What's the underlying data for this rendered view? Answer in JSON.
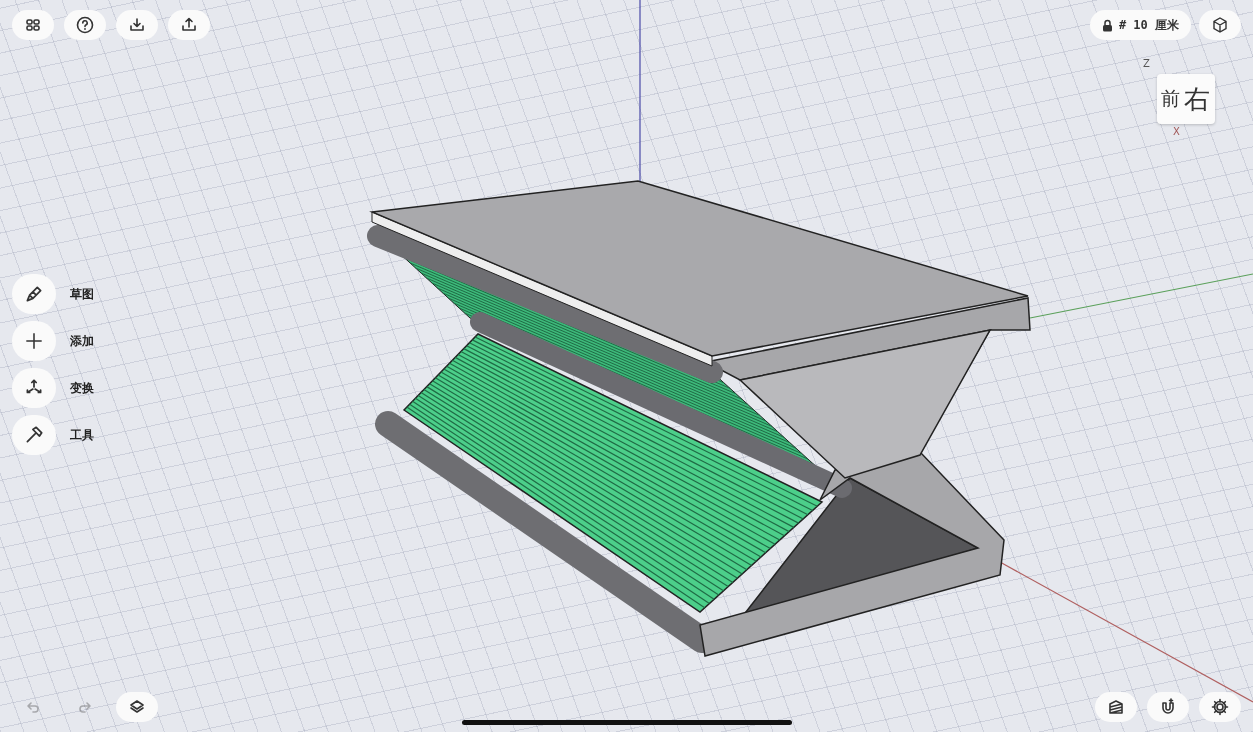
{
  "top_toolbar": [
    {
      "kind": "grid"
    },
    {
      "kind": "help"
    },
    {
      "kind": "import"
    },
    {
      "kind": "export"
    }
  ],
  "grid_size": {
    "label": "# 10 厘米",
    "locked": true
  },
  "view_cube": {
    "front": "前",
    "right": "右",
    "z_axis": "Z",
    "x_axis": "X"
  },
  "side_tools": [
    {
      "kind": "sketch",
      "label": "草图"
    },
    {
      "kind": "add",
      "label": "添加"
    },
    {
      "kind": "transform",
      "label": "变换"
    },
    {
      "kind": "tools",
      "label": "工具"
    }
  ],
  "bottom_left": [
    {
      "kind": "undo",
      "disabled": true
    },
    {
      "kind": "redo",
      "disabled": true
    },
    {
      "kind": "layers",
      "disabled": false
    }
  ],
  "bottom_right": [
    {
      "kind": "display"
    },
    {
      "kind": "snap"
    },
    {
      "kind": "settings"
    }
  ]
}
